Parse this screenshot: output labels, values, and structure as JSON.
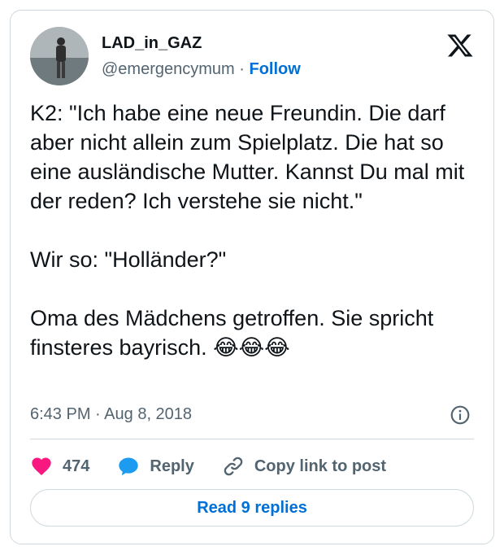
{
  "author": {
    "display_name": "LAD_in_GAZ",
    "handle": "@emergencymum",
    "separator": "·",
    "follow_label": "Follow"
  },
  "brand": {
    "logo_icon": "x-logo-icon"
  },
  "tweet": {
    "text": "K2: \"Ich habe eine neue Freundin. Die darf aber nicht allein zum Spielplatz. Die hat so eine ausländische Mutter. Kannst Du mal mit der reden? Ich verstehe sie nicht.\"\n\nWir so: \"Holländer?\"\n\nOma des Mädchens getroffen. Sie spricht finsteres bayrisch. 😂😂😂",
    "time": "6:43 PM",
    "separator": "·",
    "date": "Aug 8, 2018",
    "info_icon": "info-icon"
  },
  "actions": {
    "likes_count": "474",
    "reply_label": "Reply",
    "copy_label": "Copy link to post"
  },
  "read_replies_label": "Read 9 replies",
  "colors": {
    "like": "#f91880",
    "reply": "#1d9bf0",
    "link": "#006fd6",
    "muted": "#536471",
    "border": "#cfd9de"
  }
}
